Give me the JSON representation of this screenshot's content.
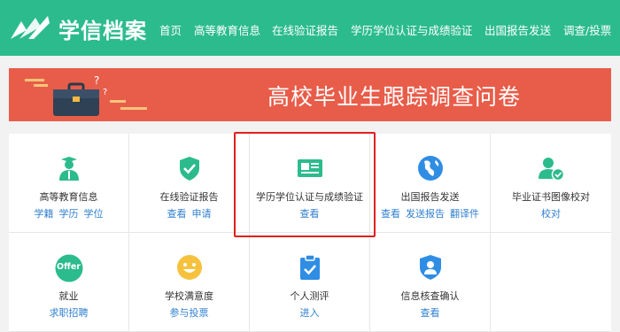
{
  "header": {
    "logo_text": "学信档案",
    "nav": [
      "首页",
      "高等教育信息",
      "在线验证报告",
      "学历学位认证与成绩验证",
      "出国报告发送",
      "调查/投票"
    ]
  },
  "banner": {
    "title": "高校毕业生跟踪调查问卷"
  },
  "services": [
    {
      "title": "高等教育信息",
      "links": [
        "学籍",
        "学历",
        "学位"
      ],
      "icon": "graduate-icon"
    },
    {
      "title": "在线验证报告",
      "links": [
        "查看",
        "申请"
      ],
      "icon": "shield-check-icon"
    },
    {
      "title": "学历学位认证与成绩验证",
      "links": [
        "查看"
      ],
      "icon": "id-card-icon"
    },
    {
      "title": "出国报告发送",
      "links": [
        "查看",
        "发送报告",
        "翻译件"
      ],
      "icon": "globe-icon"
    },
    {
      "title": "毕业证书图像校对",
      "links": [
        "校对"
      ],
      "icon": "user-check-icon"
    },
    {
      "title": "就业",
      "links": [
        "求职招聘"
      ],
      "icon": "offer-icon",
      "icon_text": "Offer"
    },
    {
      "title": "学校满意度",
      "links": [
        "参与投票"
      ],
      "icon": "smiley-icon"
    },
    {
      "title": "个人测评",
      "links": [
        "进入"
      ],
      "icon": "clipboard-check-icon"
    },
    {
      "title": "信息核查确认",
      "links": [
        "查看"
      ],
      "icon": "user-shield-icon"
    },
    {
      "title": "",
      "links": [],
      "icon": ""
    }
  ],
  "colors": {
    "header_green": "#2cbb8d",
    "banner_red": "#e85d4a",
    "link_blue": "#2f7fd0",
    "highlight_red": "#e02020"
  }
}
